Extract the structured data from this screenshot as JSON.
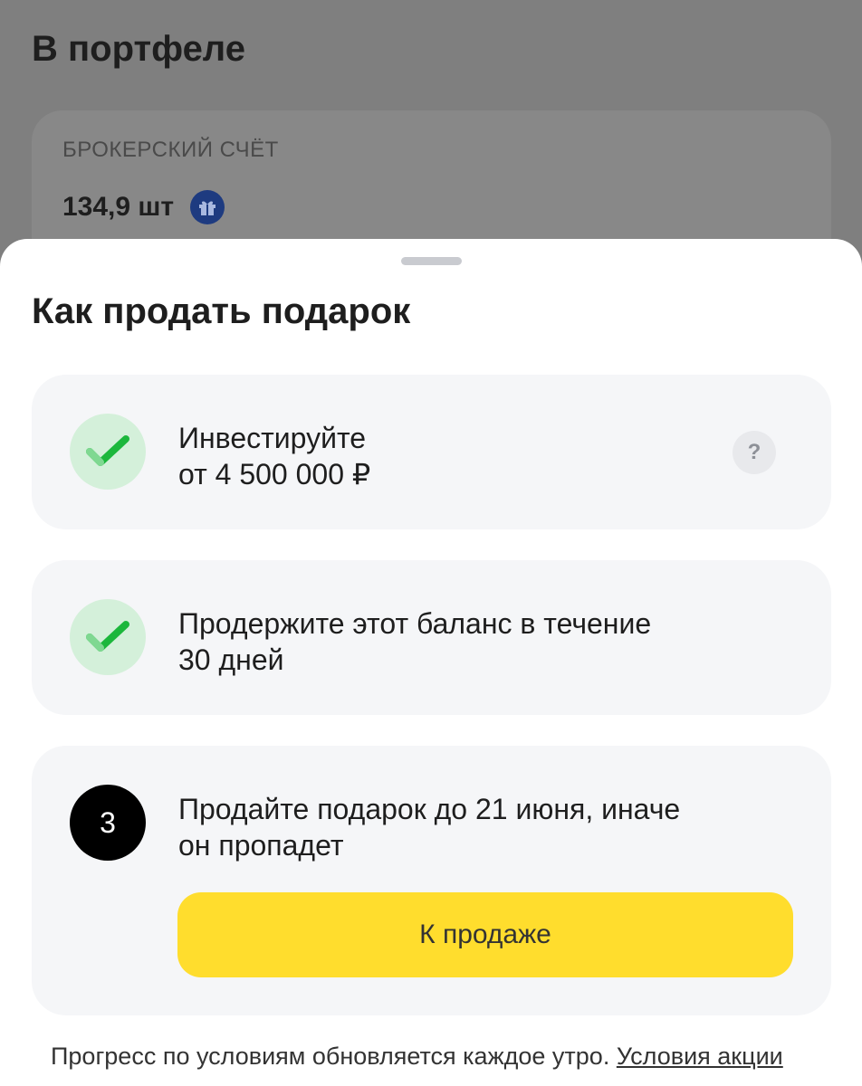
{
  "background": {
    "title": "В портфеле",
    "account_label": "БРОКЕРСКИЙ СЧЁТ",
    "quantity": "134,9 шт"
  },
  "sheet": {
    "title": "Как продать подарок",
    "steps": [
      {
        "status": "done",
        "line1": "Инвестируйте",
        "line2": "от 4 500 000 ₽",
        "help": "?"
      },
      {
        "status": "done",
        "line1": "Продержите этот баланс в течение",
        "line2": "30 дней"
      },
      {
        "status": "current",
        "number": "3",
        "line1": "Продайте подарок до 21 июня, иначе",
        "line2": "он пропадет",
        "button_label": "К продаже"
      }
    ],
    "footer_text": "Прогресс по условиям обновляется каждое утро. ",
    "footer_link": "Условия акции"
  },
  "colors": {
    "accent": "#ffdd2d",
    "check_green": "#1cb73c",
    "check_bg": "#d4f0da",
    "gift_badge": "#1e3b80"
  },
  "icons": [
    "gift-icon",
    "check-icon",
    "help-icon"
  ]
}
